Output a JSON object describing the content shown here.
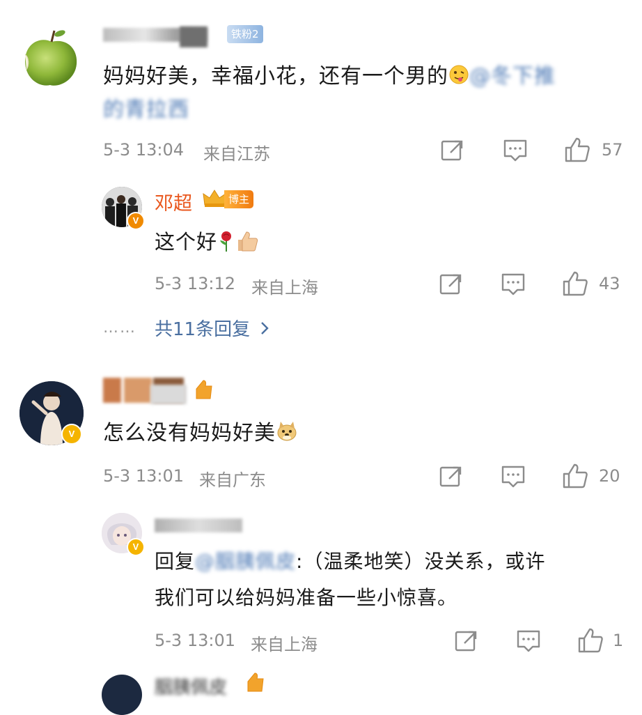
{
  "comments": [
    {
      "user": "",
      "fan_badge": "铁粉2",
      "text_a": "妈妈好美，幸福小花，还有一个男的",
      "mention_a": "@冬下推",
      "text_b": "的青拉西",
      "date": "5-3 13:04",
      "location": "来自江苏",
      "likes": "57",
      "reply": {
        "user": "邓超",
        "badge": "博主",
        "text": "这个好",
        "date": "5-3 13:12",
        "location": "来自上海",
        "likes": "43"
      },
      "more_replies": "共11条回复",
      "dots": "……"
    },
    {
      "user": "",
      "text": "怎么没有妈妈好美",
      "date": "5-3 13:01",
      "location": "来自广东",
      "likes": "20",
      "reply": {
        "user": "",
        "prefix": "回复",
        "mention": "@胭胰佩皮",
        "line1": ":（温柔地笑）没关系，或许",
        "line2": "我们可以给妈妈准备一些小惊喜。",
        "date": "5-3 13:01",
        "location": "来自上海",
        "likes": "1"
      }
    },
    {
      "user": "胭胰佩皮"
    }
  ],
  "icons": {
    "share": "share-icon",
    "comment": "comment-icon",
    "like": "thumbs-up-icon",
    "verified": "verified-v-icon",
    "chevron": "chevron-right-icon"
  },
  "colors": {
    "accent_name": "#e9561c",
    "mention": "#4a77b4",
    "meta": "#8c8c8c",
    "verified": "#f5b400"
  }
}
